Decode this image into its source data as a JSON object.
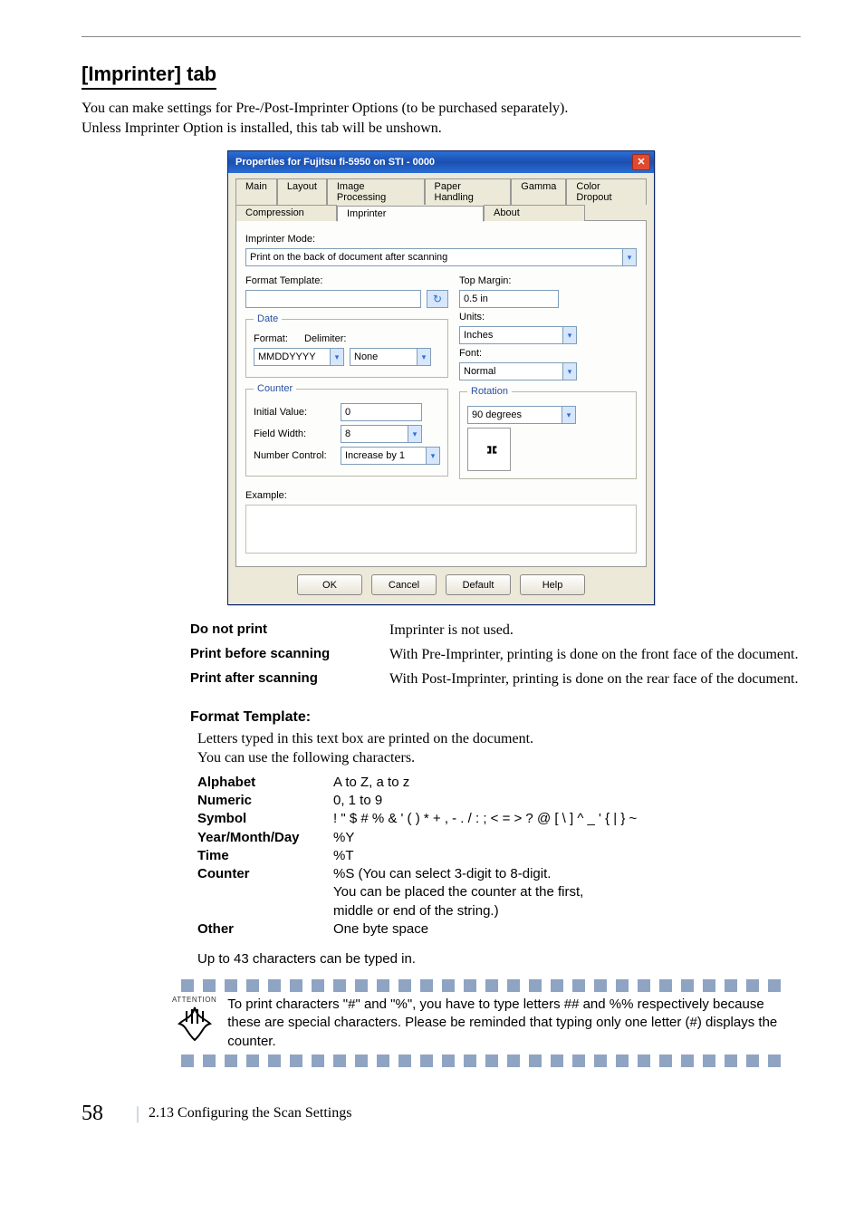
{
  "section_title": "[Imprinter] tab",
  "intro_lines": [
    "You can make settings for Pre-/Post-Imprinter Options (to be purchased separately).",
    "Unless Imprinter Option is installed, this tab will be unshown."
  ],
  "dialog": {
    "title": "Properties for Fujitsu fi-5950 on STI - 0000",
    "tabs_row1": [
      "Main",
      "Layout",
      "Image Processing",
      "Paper Handling",
      "Gamma",
      "Color Dropout"
    ],
    "tabs_row2": [
      "Compression",
      "Imprinter",
      "About"
    ],
    "active_tab": "Imprinter",
    "imprinter_mode_label": "Imprinter Mode:",
    "imprinter_mode_value": "Print on the back of document after scanning",
    "format_template_label": "Format Template:",
    "format_template_value": "",
    "top_margin_label": "Top Margin:",
    "top_margin_value": "0.5 in",
    "units_label": "Units:",
    "units_value": "Inches",
    "font_label": "Font:",
    "font_value": "Normal",
    "date_group_legend": "Date",
    "date_format_label": "Format:",
    "date_format_value": "MMDDYYYY",
    "date_delimiter_label": "Delimiter:",
    "date_delimiter_value": "None",
    "counter_group_legend": "Counter",
    "counter_initial_label": "Initial Value:",
    "counter_initial_value": "0",
    "counter_field_width_label": "Field Width:",
    "counter_field_width_value": "8",
    "counter_number_ctrl_label": "Number Control:",
    "counter_number_ctrl_value": "Increase by 1",
    "rotation_group_legend": "Rotation",
    "rotation_value": "90 degrees",
    "example_label": "Example:",
    "buttons": {
      "ok": "OK",
      "cancel": "Cancel",
      "default": "Default",
      "help": "Help"
    }
  },
  "modes": [
    {
      "term": "Do not print",
      "desc": "Imprinter is not used."
    },
    {
      "term": "Print before scanning",
      "desc": "With Pre-Imprinter, printing is done on the front face of the document."
    },
    {
      "term": "Print after scanning",
      "desc": "With Post-Imprinter, printing is done on the rear face of the document."
    }
  ],
  "format_template_heading": "Format Template:",
  "format_template_intro": [
    "Letters typed in this text box are printed on the document.",
    "You can use the following characters."
  ],
  "char_rows": [
    {
      "key": "Alphabet",
      "val": "A to Z, a to z"
    },
    {
      "key": "Numeric",
      "val": "0, 1 to 9"
    },
    {
      "key": "Symbol",
      "val": "! \" $ # % & ' ( ) * + , - . / : ; < = > ? @ [ \\ ] ^ _ ' { | } ~"
    },
    {
      "key": "Year/Month/Day",
      "val": "%Y"
    },
    {
      "key": "Time",
      "val": "%T"
    },
    {
      "key": "Counter",
      "val": "%S (You can select 3-digit to 8-digit.\nYou can be placed the counter at the first,\nmiddle or end of the string.)"
    },
    {
      "key": "Other",
      "val": "One byte space"
    }
  ],
  "limit_note": "Up to 43 characters can be typed in.",
  "attention_label": "ATTENTION",
  "attention_text": "To print characters \"#\" and \"%\", you have to type letters ## and %% respectively because these are special characters. Please be reminded that typing only one letter (#) displays the counter.",
  "footer": {
    "page": "58",
    "text": "2.13 Configuring the Scan Settings"
  }
}
